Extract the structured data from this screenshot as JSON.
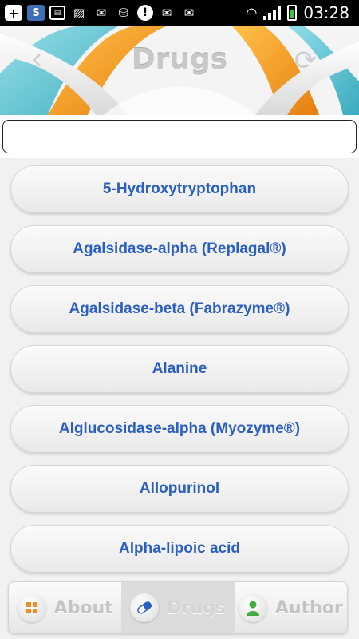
{
  "status_bar": {
    "time": "03:28",
    "icons": [
      "add-icon",
      "s-app-icon",
      "sd-card-icon",
      "image-icon",
      "mail-icon",
      "market-icon",
      "alert-icon",
      "email-icon",
      "mail-at-icon"
    ]
  },
  "header": {
    "title": "Drugs",
    "back_icon": "chevron-left-icon",
    "refresh_icon": "refresh-icon"
  },
  "search": {
    "value": "",
    "placeholder": ""
  },
  "drugs": [
    "5-Hydroxytryptophan",
    "Agalsidase-alpha (Replagal®)",
    "Agalsidase-beta (Fabrazyme®)",
    "Alanine",
    "Alglucosidase-alpha (Myozyme®)",
    "Allopurinol",
    "Alpha-lipoic acid"
  ],
  "tabs": [
    {
      "label": "About",
      "icon": "grid-icon",
      "active": false
    },
    {
      "label": "Drugs",
      "icon": "pill-icon",
      "active": true
    },
    {
      "label": "Author",
      "icon": "user-icon",
      "active": false
    }
  ],
  "colors": {
    "item_text": "#2a5fc1",
    "accent_orange": "#f29a1e",
    "accent_teal": "#35b7c9"
  }
}
